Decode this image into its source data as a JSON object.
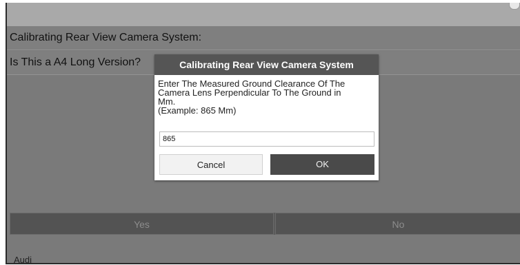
{
  "screen": {
    "row1_text": "Calibrating Rear View Camera System:",
    "row2_text": "Is This a A4 Long Version?",
    "yes_label": "Yes",
    "no_label": "No",
    "footer_text": "Audi"
  },
  "dialog": {
    "title": "Calibrating Rear View Camera System",
    "message_lines": [
      "Enter The Measured Ground Clearance Of The",
      "Camera Lens Perpendicular To The Ground in",
      "Mm.",
      "(Example: 865 Mm)"
    ],
    "input_value": "865",
    "cancel_label": "Cancel",
    "ok_label": "OK"
  },
  "colors": {
    "background": "#7a7a7a",
    "dialog_title_bg": "#555555",
    "ok_button_bg": "#4a4a4a"
  }
}
